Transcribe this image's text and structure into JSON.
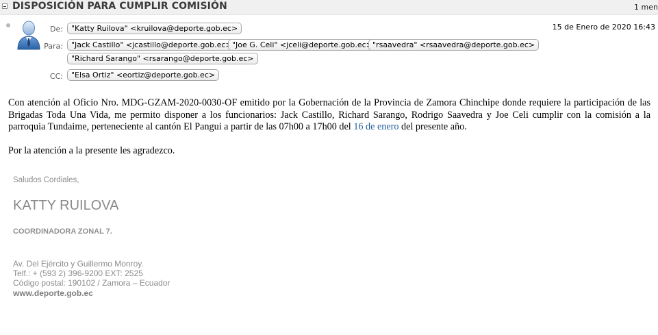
{
  "header": {
    "subject": "DISPOSICIÓN PARA CUMPLIR COMISIÓN",
    "count": "1 men"
  },
  "message": {
    "from_label": "De:",
    "from": "\"Katty Ruilova\" <kruilova@deporte.gob.ec>",
    "date": "15 de Enero de 2020 16:43",
    "to_label": "Para:",
    "to": [
      "\"Jack Castillo\" <jcastillo@deporte.gob.ec>",
      "\"Joe G. Celi\" <jceli@deporte.gob.ec>",
      "\"rsaavedra\" <rsaavedra@deporte.gob.ec>",
      "\"Richard Sarango\" <rsarango@deporte.gob.ec>"
    ],
    "cc_label": "CC:",
    "cc": [
      "\"Elsa Ortiz\" <eortiz@deporte.gob.ec>"
    ]
  },
  "body": {
    "p1_before_link": "Con atención al Oficio Nro. MDG-GZAM-2020-0030-OF emitido por la Gobernación de la Provincia de Zamora Chinchipe donde requiere la participación de las Brigadas Toda Una Vida, me permito disponer a los funcionarios: Jack Castillo, Richard Sarango, Rodrigo Saavedra y Joe Celi cumplir con la comisión a la parroquia Tundaime, perteneciente al cantón El Pangui a partir de las 07h00 a 17h00 del ",
    "p1_link": "16 de enero",
    "p1_after_link": " del presente año.",
    "p2": "Por la atención a la presente les agradezco."
  },
  "signature": {
    "greeting": "Saludos Cordiales,",
    "name": "KATTY RUILOVA",
    "role": "COORDINADORA ZONAL 7.",
    "address": "Av. Del Ejército y Guillermo Monroy.",
    "phone": "Telf.: + (593 2) 396-9200 EXT: 2525",
    "postal": "Código postal: 190102 / Zamora – Ecuador",
    "website": "www.deporte.gob.ec"
  },
  "icons": {
    "collapse": "collapse-icon",
    "avatar": "contact-avatar-icon",
    "status": "status-dot-icon"
  }
}
